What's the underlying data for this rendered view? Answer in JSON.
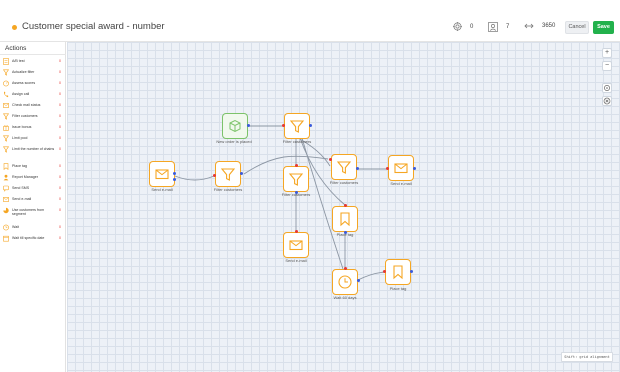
{
  "header": {
    "title": "Customer special award - number",
    "stats": [
      {
        "icon": "target-icon",
        "value": "0"
      },
      {
        "icon": "users-icon",
        "value": "7"
      },
      {
        "icon": "arrows-icon",
        "value": "3650"
      }
    ],
    "cancel_label": "Cancel",
    "save_label": "Save"
  },
  "sidebar": {
    "title": "Actions",
    "items": [
      {
        "label": "A/B test",
        "count": "0",
        "icon": "ab-test-icon"
      },
      {
        "label": "Actualize filter",
        "count": "0",
        "icon": "filter-refresh-icon"
      },
      {
        "label": "Assess scores",
        "count": "0",
        "icon": "score-icon"
      },
      {
        "label": "Assign call",
        "count": "0",
        "icon": "phone-icon"
      },
      {
        "label": "Check mail status",
        "count": "0",
        "icon": "mail-check-icon"
      },
      {
        "label": "Filter customers",
        "count": "0",
        "icon": "filter-icon"
      },
      {
        "label": "Issue bonus",
        "count": "0",
        "icon": "bonus-icon"
      },
      {
        "label": "Limit pool",
        "count": "0",
        "icon": "limit-pool-icon"
      },
      {
        "label": "Limit the number of chains",
        "count": "0",
        "icon": "limit-chains-icon"
      },
      {
        "label": "Place tag",
        "count": "0",
        "icon": "tag-icon"
      },
      {
        "label": "Report Manager",
        "count": "0",
        "icon": "report-icon"
      },
      {
        "label": "Send SMS",
        "count": "0",
        "icon": "sms-icon"
      },
      {
        "label": "Send e-mail",
        "count": "0",
        "icon": "mail-icon"
      },
      {
        "label": "Use customers from segment",
        "count": "0",
        "icon": "segment-icon"
      },
      {
        "label": "Wait",
        "count": "0",
        "icon": "clock-icon"
      },
      {
        "label": "Wait till specific date",
        "count": "0",
        "icon": "calendar-icon"
      }
    ]
  },
  "canvas": {
    "zoom_in": "+",
    "zoom_out": "−",
    "hint": "Shift: grid alignment",
    "nodes": [
      {
        "id": "new-order",
        "label": "New order is placed",
        "type": "trigger",
        "icon": "box-icon"
      },
      {
        "id": "filter-top",
        "label": "Filter customers",
        "type": "filter",
        "icon": "filter-icon"
      },
      {
        "id": "send-mail-left",
        "label": "Send e-mail",
        "type": "mail",
        "icon": "mail-icon"
      },
      {
        "id": "filter-left",
        "label": "Filter customers",
        "type": "filter",
        "icon": "filter-icon"
      },
      {
        "id": "filter-mid",
        "label": "Filter customers",
        "type": "filter",
        "icon": "filter-icon"
      },
      {
        "id": "filter-right",
        "label": "Filter customers",
        "type": "filter",
        "icon": "filter-icon"
      },
      {
        "id": "send-mail-right",
        "label": "Send e-mail",
        "type": "mail",
        "icon": "mail-icon"
      },
      {
        "id": "place-tag-mid",
        "label": "Place tag",
        "type": "tag",
        "icon": "tag-icon"
      },
      {
        "id": "send-mail-bottom",
        "label": "Send e-mail",
        "type": "mail",
        "icon": "mail-icon"
      },
      {
        "id": "wait",
        "label": "Wait 60 days",
        "type": "wait",
        "icon": "clock-icon"
      },
      {
        "id": "place-tag-right",
        "label": "Place tag",
        "type": "tag",
        "icon": "tag-icon"
      }
    ]
  },
  "colors": {
    "accent": "#f5a623",
    "save": "#22b14c",
    "trigger": "#7cc36a",
    "port_in": "#e53935",
    "port_out": "#3b5bdb",
    "canvas_bg": "#edf1f7"
  }
}
